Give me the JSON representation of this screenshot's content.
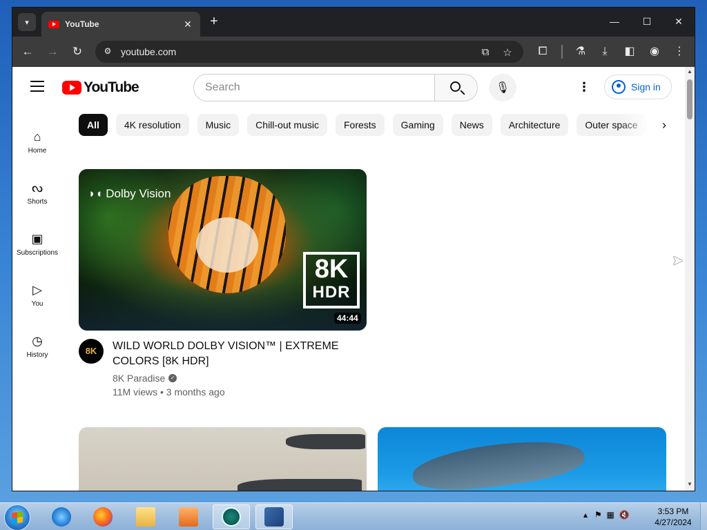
{
  "browser": {
    "tab_title": "YouTube",
    "tab_close": "✕",
    "new_tab": "+",
    "url": "youtube.com",
    "window_controls": {
      "minimize": "—",
      "maximize": "☐",
      "close": "✕"
    }
  },
  "youtube": {
    "logo_text": "YouTube",
    "search_placeholder": "Search",
    "sign_in": "Sign in",
    "guide": [
      {
        "label": "Home",
        "icon": "home-icon"
      },
      {
        "label": "Shorts",
        "icon": "shorts-icon"
      },
      {
        "label": "Subscriptions",
        "icon": "subscriptions-icon"
      },
      {
        "label": "You",
        "icon": "you-icon"
      },
      {
        "label": "History",
        "icon": "history-icon"
      }
    ],
    "chips": [
      "All",
      "4K resolution",
      "Music",
      "Chill-out music",
      "Forests",
      "Gaming",
      "News",
      "Architecture",
      "Outer space"
    ],
    "video": {
      "title": "WILD WORLD DOLBY VISION™ | EXTREME COLORS [8K HDR]",
      "channel": "8K Paradise",
      "meta": "11M views • 3 months ago",
      "duration": "44:44",
      "thumb_brand": "Dolby Vision",
      "badge_top": "8K",
      "badge_bottom": "HDR",
      "avatar_text": "8K"
    }
  },
  "taskbar": {
    "time": "3:53 PM",
    "date": "4/27/2024"
  },
  "colors": {
    "youtube_red": "#ff0000",
    "link_blue": "#065fd4",
    "chrome_dark": "#202124"
  }
}
